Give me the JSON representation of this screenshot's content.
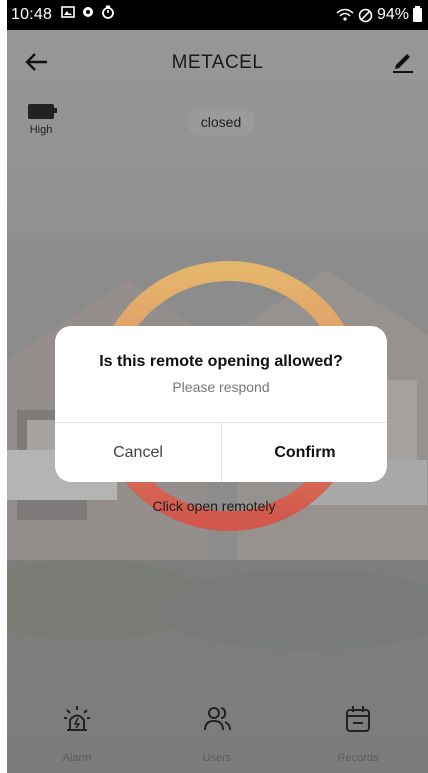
{
  "status_bar": {
    "time": "10:48",
    "battery_percent": "94%",
    "icons": [
      "image-icon",
      "settings-icon",
      "timer-icon",
      "wifi-icon",
      "do-not-disturb-icon",
      "battery-icon"
    ]
  },
  "header": {
    "title": "METACEL",
    "back_icon": "arrow-left-icon",
    "edit_icon": "pencil-icon"
  },
  "device": {
    "battery_label": "High",
    "state": "closed"
  },
  "open_control": {
    "label": "Click open remotely",
    "ring_colors": [
      "#e7b86b",
      "#e08763",
      "#d95a4e"
    ]
  },
  "dialog": {
    "title": "Is this remote opening allowed?",
    "message": "Please respond",
    "cancel_label": "Cancel",
    "confirm_label": "Confirm"
  },
  "tabs": [
    {
      "label": "Alarm",
      "icon": "alarm-siren-icon"
    },
    {
      "label": "Users",
      "icon": "users-icon"
    },
    {
      "label": "Records",
      "icon": "calendar-icon"
    }
  ]
}
